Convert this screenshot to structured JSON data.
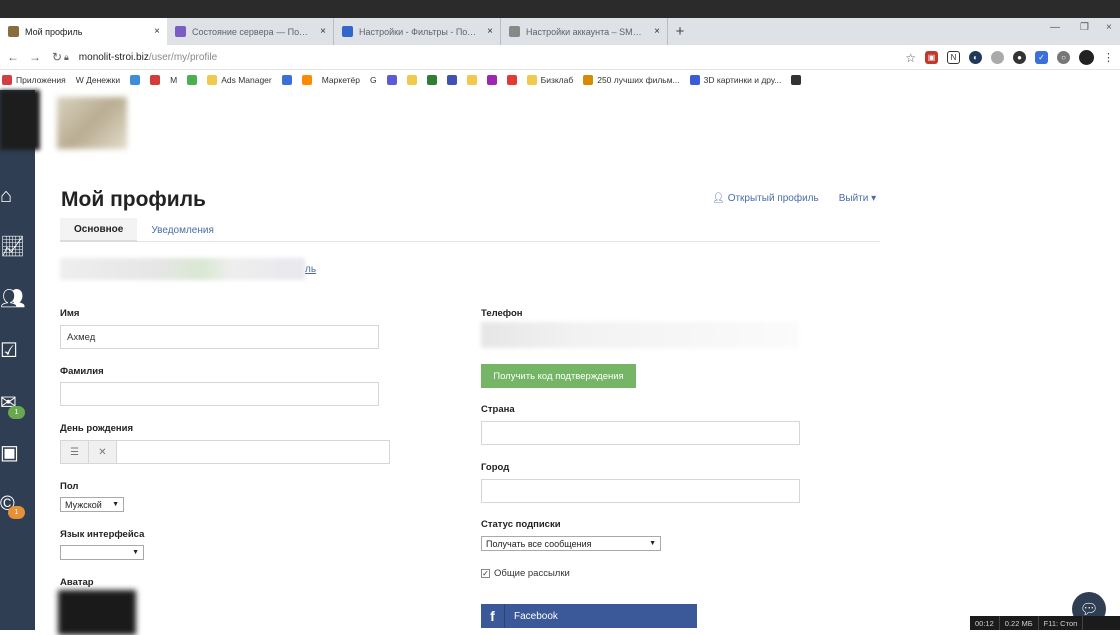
{
  "browser": {
    "tabs": [
      {
        "label": "Мой профиль",
        "fav_color": "#8a6d3b"
      },
      {
        "label": "Состояние сервера — Почта —",
        "fav_color": "#7b5cc4"
      },
      {
        "label": "Настройки - Фильтры - Почта M",
        "fav_color": "#3366cc"
      },
      {
        "label": "Настройки аккаунта – SMS-цен",
        "fav_color": "#888888"
      }
    ],
    "new_tab": "+",
    "close_glyph": "×",
    "url_host": "monolit-stroi.biz",
    "url_path": "/user/my/profile",
    "window_minimize": "—",
    "window_restore": "❐",
    "window_close": "×"
  },
  "bookmarks": [
    {
      "label": "Приложения",
      "color": "#d04040"
    },
    {
      "label": "W Денежки",
      "color": "#ffffff"
    },
    {
      "label": "",
      "color": "#3b8fd9"
    },
    {
      "label": "",
      "color": "#d43c3c"
    },
    {
      "label": "M",
      "color": "#ffffff"
    },
    {
      "label": "",
      "color": "#4caf50"
    },
    {
      "label": "Ads Manager",
      "color": "#f2c94c"
    },
    {
      "label": "",
      "color": "#3b6fd9"
    },
    {
      "label": "",
      "color": "#ff8a00"
    },
    {
      "label": "Маркетёр",
      "color": "#ffffff"
    },
    {
      "label": "G",
      "color": "#ffffff"
    },
    {
      "label": "",
      "color": "#5b5bd6"
    },
    {
      "label": "",
      "color": "#f2c94c"
    },
    {
      "label": "",
      "color": "#2e7d32"
    },
    {
      "label": "",
      "color": "#3f51b5"
    },
    {
      "label": "",
      "color": "#f2c94c"
    },
    {
      "label": "",
      "color": "#9c27b0"
    },
    {
      "label": "",
      "color": "#e53935"
    },
    {
      "label": "Бизклаб",
      "color": "#f2c94c"
    },
    {
      "label": "250 лучших фильм...",
      "color": "#d68a00"
    },
    {
      "label": "3D картинки и дру...",
      "color": "#3b5bd9"
    },
    {
      "label": "",
      "color": "#333333"
    }
  ],
  "sidebar": {
    "badges": [
      "1",
      "1"
    ]
  },
  "page": {
    "title": "Мой профиль",
    "open_profile": "Открытый профиль",
    "logout": "Выйти ▾",
    "tabs": [
      "Основное",
      "Уведомления"
    ],
    "email_link": "ль"
  },
  "form": {
    "name_label": "Имя",
    "name_value": "Ахмед",
    "surname_label": "Фамилия",
    "surname_value": "",
    "birthday_label": "День рождения",
    "gender_label": "Пол",
    "gender_value": "Мужской",
    "language_label": "Язык интерфейса",
    "language_value": "",
    "avatar_label": "Аватар",
    "phone_label": "Телефон",
    "get_code_button": "Получить код подтверждения",
    "country_label": "Страна",
    "city_label": "Город",
    "subscription_label": "Статус подписки",
    "subscription_value": "Получать все сообщения",
    "newsletter_label": "Общие рассылки",
    "facebook_label": "Facebook"
  },
  "statusbar": [
    "00:12",
    "0.22 МБ",
    "F11: Стоп"
  ],
  "colors": {
    "sidebar": "#2f3e53",
    "badge_green": "#6aa84f",
    "badge_orange": "#e69138",
    "link": "#4a6da7",
    "green_button": "#74b566",
    "facebook": "#3b5998"
  }
}
